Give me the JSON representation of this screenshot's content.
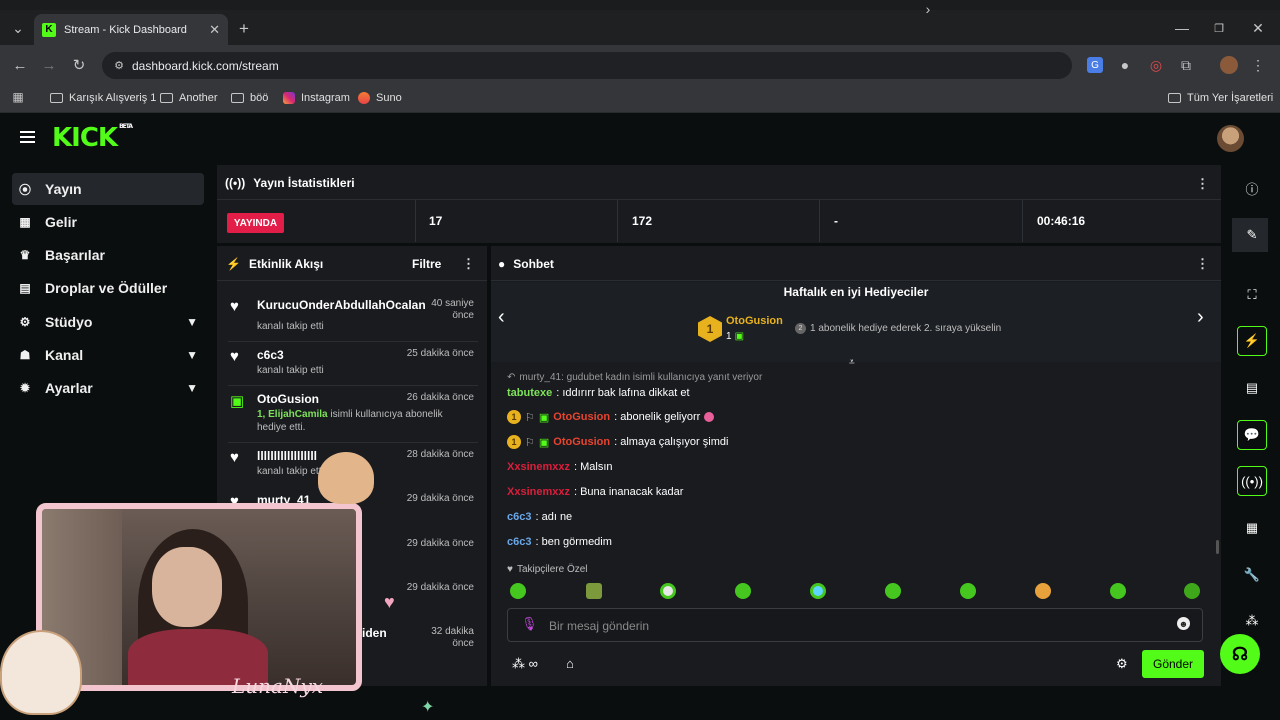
{
  "browser": {
    "tab_title": "Stream - Kick Dashboard",
    "url": "dashboard.kick.com/stream",
    "bookmarks": [
      "Karışık Alışveriş 1",
      "Another",
      "böö",
      "Instagram",
      "Suno"
    ],
    "all_bookmarks": "Tüm Yer İşaretleri"
  },
  "brand": {
    "logo": "KICK",
    "beta": "BETA",
    "accent": "#53fc18"
  },
  "sidebar": {
    "items": [
      {
        "label": "Yayın",
        "icon": "broadcast-icon"
      },
      {
        "label": "Gelir",
        "icon": "chart-icon"
      },
      {
        "label": "Başarılar",
        "icon": "trophy-icon"
      },
      {
        "label": "Droplar ve Ödüller",
        "icon": "gift-icon"
      },
      {
        "label": "Stüdyo",
        "icon": "studio-icon"
      },
      {
        "label": "Kanal",
        "icon": "users-icon"
      },
      {
        "label": "Ayarlar",
        "icon": "gear-icon"
      }
    ]
  },
  "stats": {
    "title": "Yayın İstatistikleri",
    "live": "YAYINDA",
    "viewers": "17",
    "followers": "172",
    "other": "-",
    "duration": "00:46:16"
  },
  "activity": {
    "title": "Etkinlik Akışı",
    "filter": "Filtre",
    "items": [
      {
        "name": "KurucuOnderAbdullahOcalan",
        "desc": "kanalı takip etti",
        "time1": "40 saniye",
        "time2": "önce"
      },
      {
        "name": "c6c3",
        "desc": "kanalı takip etti",
        "time1": "25 dakika önce",
        "time2": ""
      },
      {
        "name": "OtoGusion",
        "desc_highlight": "1, ElijahCamila",
        "desc": "isimli kullanıcıya abonelik",
        "desc2": "hediye etti.",
        "time1": "26 dakika önce",
        "time2": ""
      },
      {
        "name": "llllllllllllllllll",
        "desc": "kanalı takip etti",
        "time1": "28 dakika önce",
        "time2": ""
      },
      {
        "name": "murty_41",
        "desc": "",
        "time1": "29 dakika önce",
        "time2": ""
      },
      {
        "name": "",
        "desc": "",
        "time1": "29 dakika önce",
        "time2": ""
      },
      {
        "name": "",
        "desc": "",
        "time1": "29 dakika önce",
        "time2": ""
      },
      {
        "name": "eniden",
        "desc": "",
        "time1": "32 dakika",
        "time2": "önce"
      }
    ]
  },
  "chat": {
    "title": "Sohbet",
    "top_gifters": "Haftalık en iyi Hediyeciler",
    "top_user": "OtoGusion",
    "top_rank": "1",
    "top_count": "1",
    "gift_hint": "1 abonelik hediye ederek 2. sıraya yükselin",
    "reply_note": "murty_41: gudubet kadın isimli kullanıcıya yanıt veriyor",
    "messages": [
      {
        "user": "tabutexe",
        "text": ": ıddırırr bak lafına dikkat et",
        "color": "green"
      },
      {
        "user": "OtoGusion",
        "text": ": abonelik geliyorr",
        "color": "orange",
        "badges": true
      },
      {
        "user": "OtoGusion",
        "text": ": almaya çalışıyor şimdi",
        "color": "orange",
        "badges": true
      },
      {
        "user": "Xxsinemxxz",
        "text": ": Malsın",
        "color": "red"
      },
      {
        "user": "Xxsinemxxz",
        "text": ": Buna inanacak kadar",
        "color": "red"
      },
      {
        "user": "c6c3",
        "text": ": adı ne",
        "color": "blue"
      },
      {
        "user": "c6c3",
        "text": ": ben görmedim",
        "color": "blue"
      }
    ],
    "emote_section": "Takipçilere Özel",
    "input_placeholder": "Bir mesaj gönderin",
    "send": "Gönder"
  },
  "overlay": {
    "signature": "LunaNyx"
  }
}
